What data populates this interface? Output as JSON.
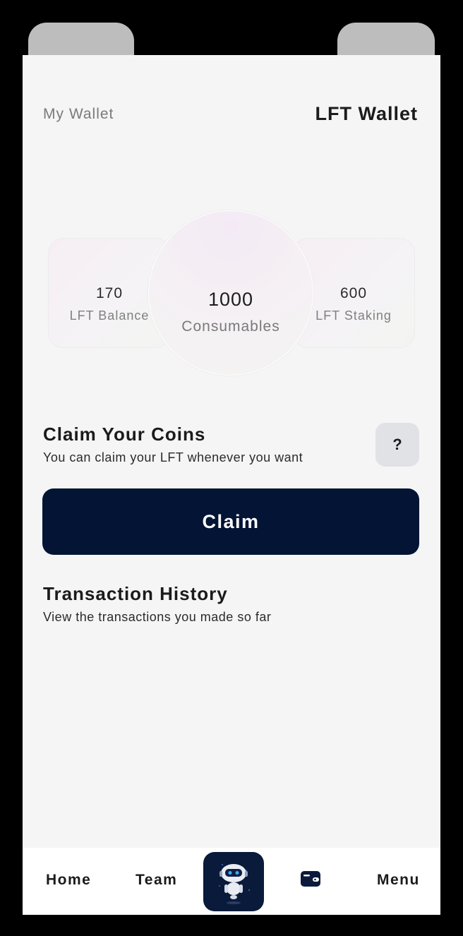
{
  "header": {
    "left_label": "My Wallet",
    "title": "LFT Wallet"
  },
  "balances": {
    "left": {
      "value": "170",
      "label": "LFT Balance"
    },
    "center": {
      "value": "1000",
      "label": "Consumables"
    },
    "right": {
      "value": "600",
      "label": "LFT Staking"
    }
  },
  "claim": {
    "title": "Claim Your Coins",
    "subtitle": "You can claim your LFT whenever you want",
    "help_label": "?",
    "button_label": "Claim"
  },
  "transactions": {
    "title": "Transaction History",
    "subtitle": "View the transactions you made so far"
  },
  "bottom_nav": {
    "home": "Home",
    "team": "Team",
    "center_icon": "robot-icon",
    "wallet_icon": "wallet-icon",
    "menu": "Menu"
  },
  "colors": {
    "primary_dark": "#031434",
    "background": "#f5f5f5"
  }
}
